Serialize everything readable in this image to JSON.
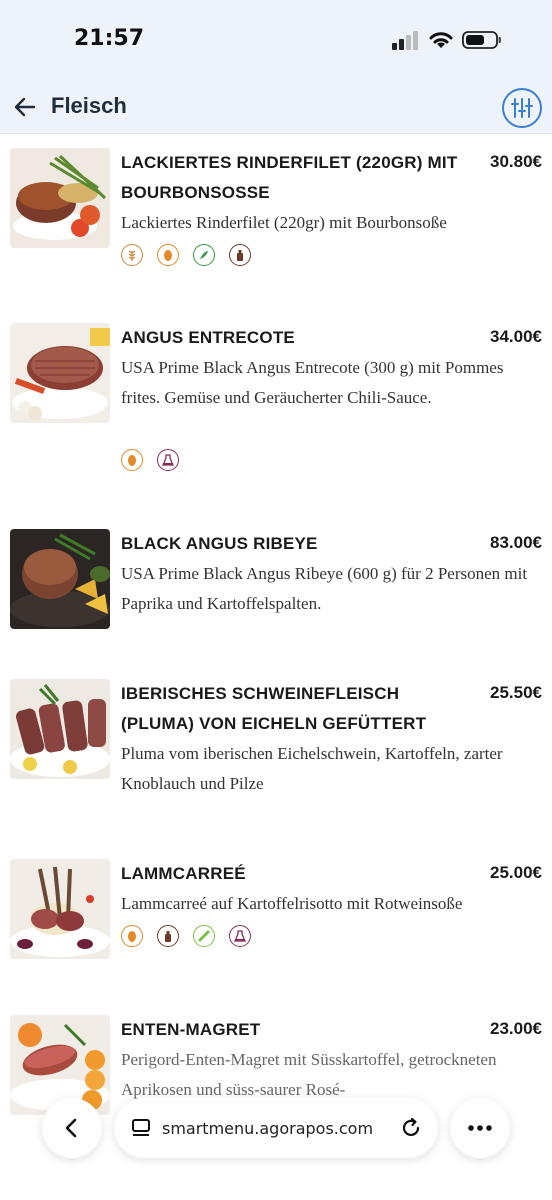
{
  "status_bar": {
    "time": "21:57"
  },
  "nav": {
    "title": "Fleisch",
    "back_icon": "arrow-left-icon",
    "filter_icon": "sliders-icon"
  },
  "items": [
    {
      "name": "LACKIERTES RINDERFILET (220GR) MIT BOURBONSOSSE",
      "price": "30.80€",
      "description": "Lackiertes Rinderfilet (220gr) mit Bourbonsoße",
      "allergens": [
        "gluten",
        "egg",
        "celery",
        "soy"
      ]
    },
    {
      "name": "ANGUS ENTRECOTE",
      "price": "34.00€",
      "description": "USA Prime Black Angus Entrecote (300 g) mit Pommes frites. Gemüse und Geräucherter Chili-Sauce.",
      "allergens": [
        "egg",
        "sulphites"
      ]
    },
    {
      "name": "BLACK ANGUS RIBEYE",
      "price": "83.00€",
      "description": "USA Prime Black Angus Ribeye (600 g) für 2 Personen mit Paprika und Kartoffelspalten.",
      "allergens": []
    },
    {
      "name": "IBERISCHES SCHWEINEFLEISCH (PLUMA) VON EICHELN GEFÜTTERT",
      "price": "25.50€",
      "description": "Pluma vom iberischen Eichelschwein, Kartoffeln, zarter Knoblauch und Pilze",
      "allergens": []
    },
    {
      "name": "LAMMCARREÉ",
      "price": "25.00€",
      "description": "Lammcarreé auf Kartoffelrisotto mit Rotweinsoße",
      "allergens": [
        "egg",
        "soy",
        "mustard",
        "sulphites"
      ]
    },
    {
      "name": "ENTEN-MAGRET",
      "price": "23.00€",
      "description": "Perigord-Enten-Magret mit Süsskartoffel, getrockneten Aprikosen und süss-saurer Rosé-",
      "allergens": []
    }
  ],
  "browser": {
    "url": "smartmenu.agorapos.com"
  },
  "colors": {
    "accent": "#3b7fd4",
    "gluten": "#c98a3a",
    "egg": "#e08a2a",
    "celery": "#2e9a3e",
    "soy": "#6b3a2a",
    "sulphites": "#8a2a5a",
    "mustard": "#7ac043"
  }
}
